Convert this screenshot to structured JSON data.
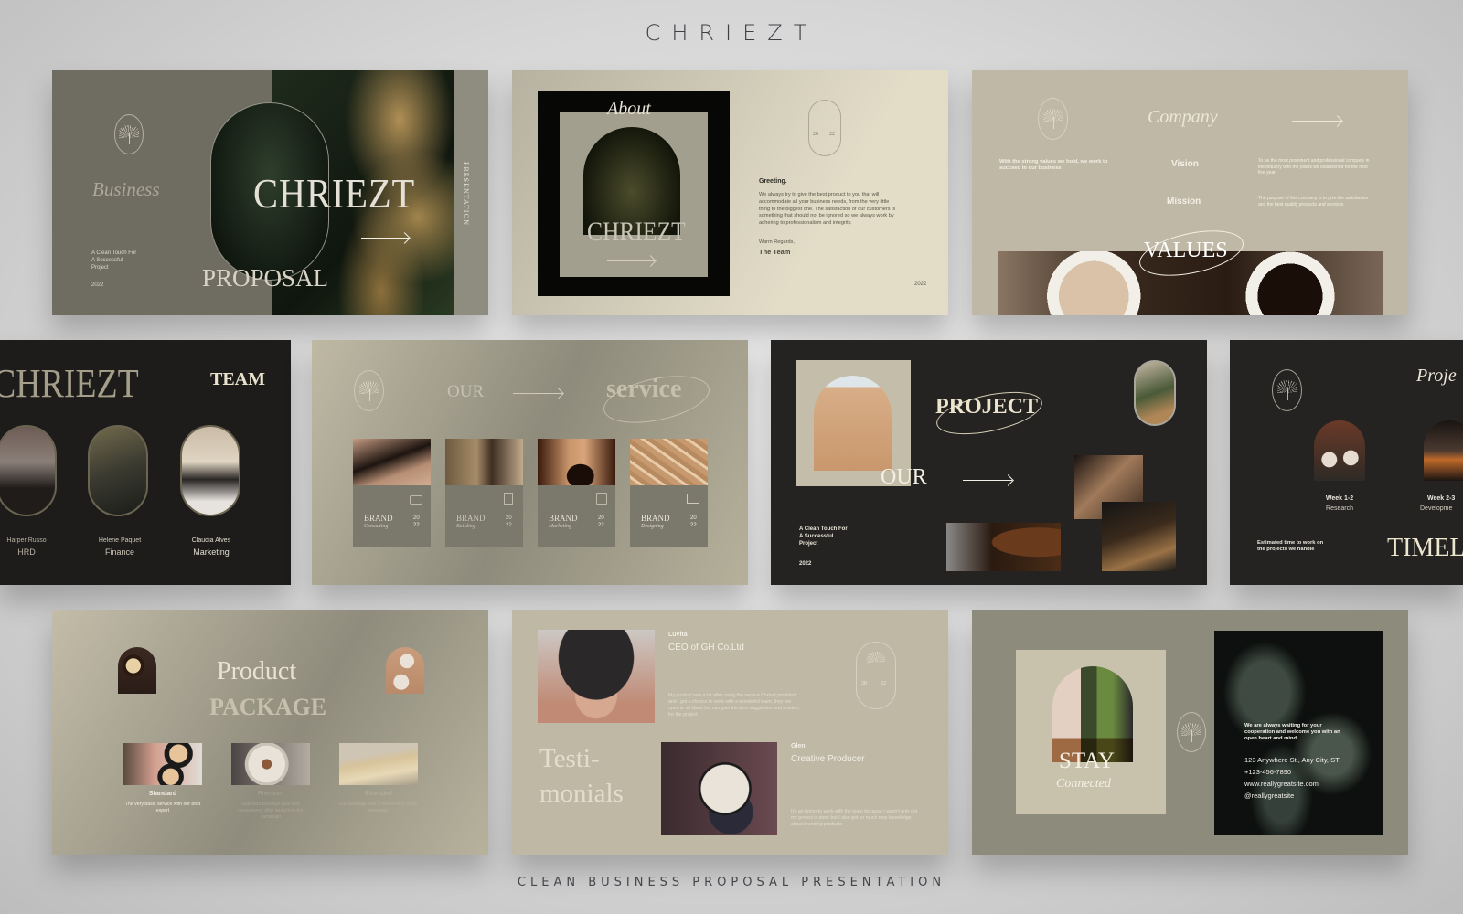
{
  "header": {
    "brand": "CHRIEZT"
  },
  "footer": {
    "tagline": "CLEAN BUSINESS PROPOSAL PRESENTATION"
  },
  "slides": {
    "cover": {
      "script_word": "Business",
      "logo": "CHRIEZT",
      "subtitle": "PROPOSAL",
      "vertical_label": "PRESENTATION",
      "tagline_lines": [
        "A Clean Touch For",
        "A Successful",
        "Project"
      ],
      "year": "2022"
    },
    "about": {
      "title": "About",
      "logo": "CHRIEZT",
      "emblem_year_left": "20",
      "emblem_year_right": "22",
      "greeting_heading": "Greeting.",
      "greeting_body": "We always try to give the best product to you that will accommodate all your business needs, from the very little thing to the biggest one. The satisfaction of our customers is something that should not be ignored so we always work by adhering to professionalism and integrity.",
      "closing": "Warm Regards,",
      "signature": "The Team",
      "year": "2022"
    },
    "company": {
      "title": "Company",
      "intro": "With the strong values we hold, we work to succeed in our business",
      "vision_label": "Vision",
      "vision_text": "To be the most prominent and professional company in the industry with the pillars we established for the next five year",
      "mission_label": "Mission",
      "mission_text": "The purpose of this company is to give the satisfaction and the best quality products and services",
      "values_label": "VALUES"
    },
    "team": {
      "logo": "CHRIEZT",
      "title": "TEAM",
      "members": [
        {
          "name": "Harper Russo",
          "role": "HRD"
        },
        {
          "name": "Helene Paquet",
          "role": "Finance"
        },
        {
          "name": "Claudia Alves",
          "role": "Marketing"
        }
      ]
    },
    "service": {
      "title_left": "OUR",
      "title_right": "service",
      "cards": [
        {
          "brand": "BRAND",
          "type": "Consulting",
          "year_top": "20",
          "year_bottom": "22",
          "icon": "chat-icon"
        },
        {
          "brand": "BRAND",
          "type": "Building",
          "year_top": "20",
          "year_bottom": "22",
          "icon": "document-edit-icon"
        },
        {
          "brand": "BRAND",
          "type": "Marketing",
          "year_top": "20",
          "year_bottom": "22",
          "icon": "network-icon"
        },
        {
          "brand": "BRAND",
          "type": "Designing",
          "year_top": "20",
          "year_bottom": "22",
          "icon": "monitor-icon"
        }
      ]
    },
    "project": {
      "title": "PROJECT",
      "prefix": "OUR",
      "tagline_lines": [
        "A Clean Touch For",
        "A Successful",
        "Project"
      ],
      "year": "2022"
    },
    "timeline": {
      "title_script": "Proje",
      "title_big": "TIMEL",
      "note": "Estimated time to work on the projects we handle",
      "steps": [
        {
          "week": "Week 1-2",
          "phase": "Research"
        },
        {
          "week": "Week 2-3",
          "phase": "Developme"
        }
      ]
    },
    "product": {
      "title_top": "Product",
      "title_bottom": "PACKAGE",
      "packages": [
        {
          "name": "Standard",
          "desc": "The very basic service with our best expert"
        },
        {
          "name": "Premium",
          "desc": "Standard package plus free consultancy after launching the campaign"
        },
        {
          "name": "Extended",
          "desc": "Full package with a free review of the campaign"
        }
      ]
    },
    "testimonials": {
      "title_line1": "Testi-",
      "title_line2": "monials",
      "emblem_year_left": "20",
      "emblem_year_right": "22",
      "items": [
        {
          "name": "Luvita",
          "role": "CEO of GH Co.Ltd",
          "quote": "My product was a hit after using the service Chriezt provided and I got a chance to work with a wonderful team, they are open to all ideas but can give the best suggestion and solution for the project"
        },
        {
          "name": "Glen",
          "role": "Creative Producer",
          "quote": "It's an honor to work with the team because I wasn't only got my project is done but I also got so much new knowledge about branding products"
        }
      ]
    },
    "contact": {
      "title": "STAY",
      "subtitle": "Connected",
      "message": "We are always waiting for your cooperation and welcome you with an open heart and mind",
      "address": "123 Anywhere St., Any City, ST",
      "phone": "+123-456-7890",
      "website": "www.reallygreatsite.com",
      "social": "@reallygreatsite"
    }
  }
}
